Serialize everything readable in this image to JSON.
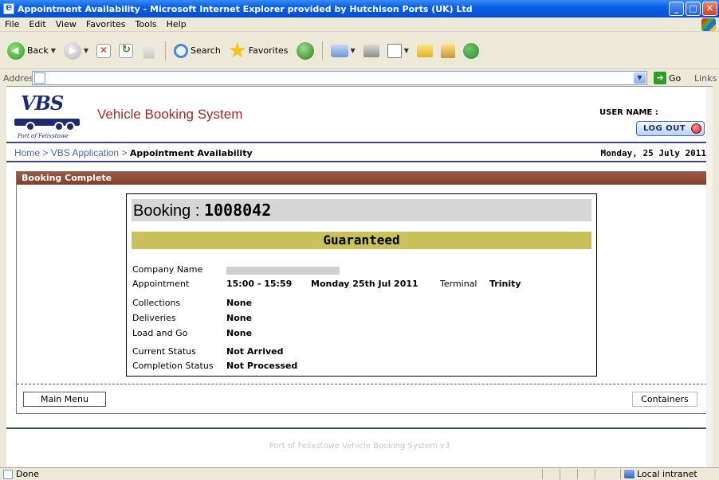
{
  "window": {
    "title": "Appointment Availability - Microsoft Internet Explorer provided by Hutchison Ports (UK) Ltd"
  },
  "menu": [
    "File",
    "Edit",
    "View",
    "Favorites",
    "Tools",
    "Help"
  ],
  "toolbar": {
    "back_label": "Back",
    "search_label": "Search",
    "favorites_label": "Favorites"
  },
  "address": {
    "label": "Address",
    "go_label": "Go",
    "links_label": "Links"
  },
  "header": {
    "logo_text": "VBS",
    "logo_subtext": "Port of Felixstowe",
    "site_title": "Vehicle Booking System",
    "user_name_label": "USER NAME :",
    "logout_label": "LOG OUT"
  },
  "breadcrumb": {
    "home": "Home",
    "sep": ">",
    "app": "VBS Application",
    "current": "Appointment Availability"
  },
  "page_date": "Monday, 25 July 2011",
  "panel": {
    "title": "Booking Complete",
    "booking_label": "Booking :",
    "booking_number": "1008042",
    "status_banner": "Guaranteed",
    "fields": {
      "company_name_label": "Company Name",
      "appointment_label": "Appointment",
      "appointment_time": "15:00 - 15:59",
      "appointment_date": "Monday 25th Jul 2011",
      "terminal_label": "Terminal",
      "terminal_value": "Trinity",
      "collections_label": "Collections",
      "collections_value": "None",
      "deliveries_label": "Deliveries",
      "deliveries_value": "None",
      "load_and_go_label": "Load and Go",
      "load_and_go_value": "None",
      "current_status_label": "Current Status",
      "current_status_value": "Not Arrived",
      "completion_status_label": "Completion Status",
      "completion_status_value": "Not Processed"
    },
    "main_menu_label": "Main Menu",
    "containers_label": "Containers"
  },
  "footer": {
    "text": "Port of Felixstowe Vehicle Booking System v3"
  },
  "status": {
    "left": "Done",
    "zone": "Local intranet"
  },
  "colors": {
    "brand_red": "#9b2d20",
    "navy": "#3b4a78",
    "panel_header": "#7e3f2b",
    "guaranteed": "#c9c25a"
  }
}
